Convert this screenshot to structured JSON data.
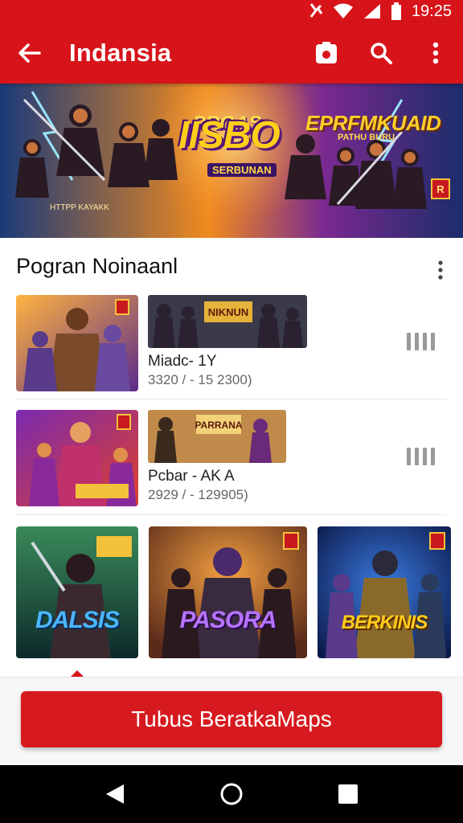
{
  "status_bar": {
    "time": "19:25",
    "icons": [
      "nfc-icon",
      "wifi-icon",
      "signal-icon",
      "battery-icon"
    ]
  },
  "app_bar": {
    "title": "Indansia",
    "icons": [
      "back-arrow-icon",
      "camera-icon",
      "search-icon",
      "more-vert-icon"
    ]
  },
  "banner": {
    "title_top": "PROAS",
    "title": "IISBO",
    "subtitle": "SERBUNAN",
    "right_title": "EPRFMKUAID",
    "right_sub": "PATHU BURU",
    "tag": "HTTPP KAYAKK",
    "badge": "R"
  },
  "section": {
    "title": "Pogran Noinaanl",
    "items": [
      {
        "thumb_title": "NIKNUN",
        "name": "Miadc- 1Y",
        "meta": "3320 / - 15 2300)"
      },
      {
        "thumb_title": "PARRANA",
        "name": "Pcbar - AK A",
        "meta": "2929 / - 129905)"
      }
    ],
    "grid": [
      {
        "label": "DALSIS"
      },
      {
        "label": "PASORA"
      },
      {
        "label": "BERKINIS"
      }
    ]
  },
  "cta": {
    "label": "Tubus BeratkaMaps"
  },
  "colors": {
    "primary": "#d7141a",
    "text": "#111111",
    "meta": "#666666"
  }
}
